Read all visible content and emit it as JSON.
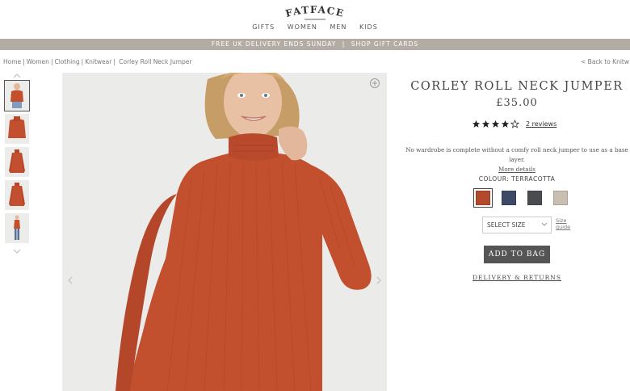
{
  "brand": {
    "logo_text": "FATFACE"
  },
  "nav": {
    "items": [
      "GIFTS",
      "WOMEN",
      "MEN",
      "KIDS"
    ]
  },
  "promo": {
    "delivery": "FREE UK DELIVERY ENDS SUNDAY",
    "separator": "|",
    "shop_gift_cards": "SHOP GIFT CARDS"
  },
  "breadcrumb": {
    "items": [
      "Home",
      "Women",
      "Clothing",
      "Knitwear",
      "Corley Roll Neck Jumper"
    ],
    "separator": "|"
  },
  "back_link": "< Back to Knitw",
  "product": {
    "title": "CORLEY ROLL NECK JUMPER",
    "price": "£35.00",
    "rating": 4,
    "rating_max": 5,
    "reviews_label": "2 reviews",
    "description": "No wardrobe is complete without a comfy roll neck jumper to use as a base layer.",
    "more_details": "More details",
    "colour_label": "COLOUR: TERRACOTTA",
    "swatches": [
      {
        "name": "Terracotta",
        "color": "#b34a2c",
        "selected": true
      },
      {
        "name": "Navy",
        "color": "#3c4a66",
        "selected": false
      },
      {
        "name": "Charcoal",
        "color": "#4a4c4f",
        "selected": false
      },
      {
        "name": "Oatmeal",
        "color": "#c9bfb0",
        "selected": false
      }
    ],
    "size_select": "SELECT SIZE",
    "size_guide": "Size guide",
    "add_to_bag": "ADD TO BAG",
    "delivery_returns": "DELIVERY & RETURNS"
  },
  "thumbnails": [
    {
      "icon": "model-front-thumbnail",
      "active": true
    },
    {
      "icon": "jumper-detail-thumbnail",
      "active": false
    },
    {
      "icon": "jumper-flat-front-thumbnail",
      "active": false
    },
    {
      "icon": "jumper-flat-back-thumbnail",
      "active": false
    },
    {
      "icon": "model-full-length-thumbnail",
      "active": false
    }
  ],
  "colors": {
    "promo_bar": "#b3aca4",
    "jumper": "#c2502f",
    "button": "#555555"
  }
}
